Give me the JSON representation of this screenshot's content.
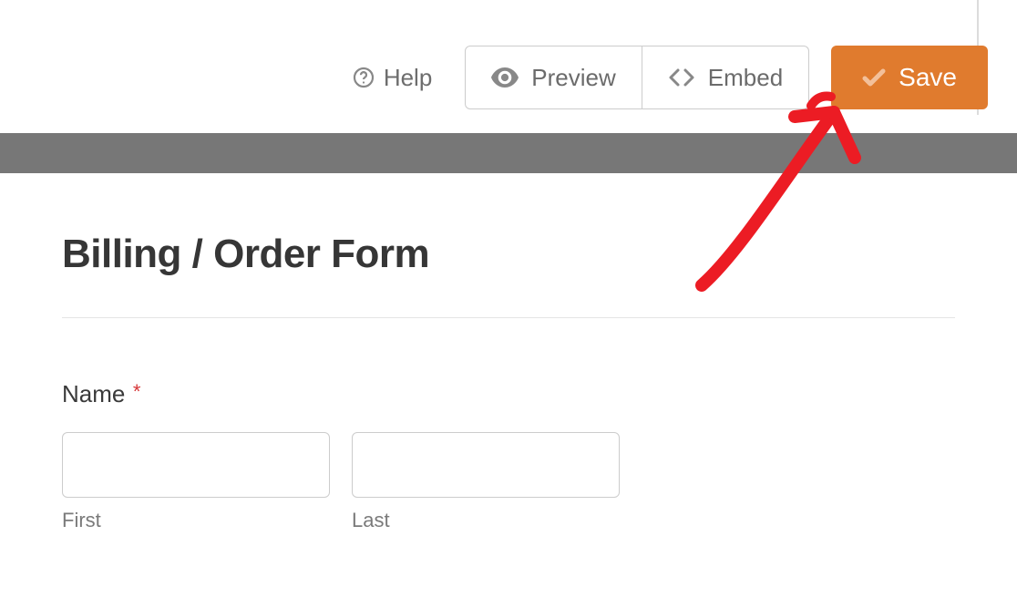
{
  "toolbar": {
    "help_label": "Help",
    "preview_label": "Preview",
    "embed_label": "Embed",
    "save_label": "Save"
  },
  "form": {
    "title": "Billing / Order Form",
    "fields": {
      "name": {
        "label": "Name",
        "required_marker": "*",
        "first": {
          "sublabel": "First",
          "value": ""
        },
        "last": {
          "sublabel": "Last",
          "value": ""
        }
      }
    }
  }
}
